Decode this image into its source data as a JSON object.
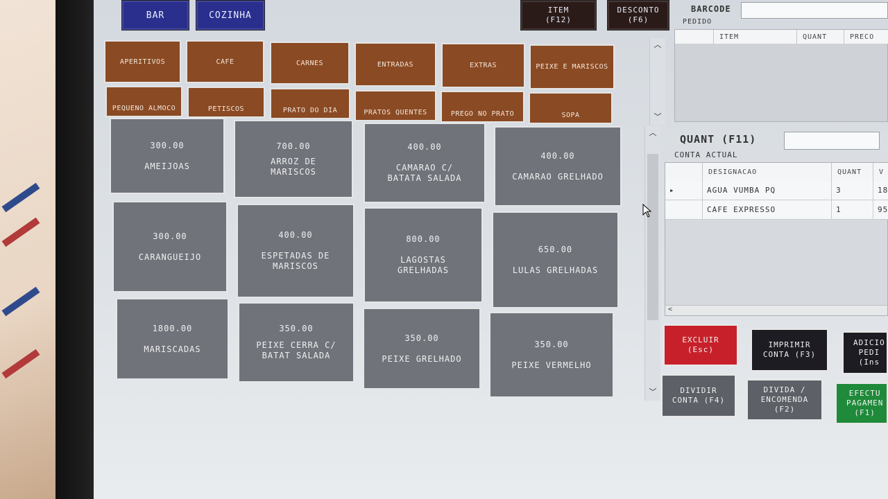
{
  "top_buttons": {
    "bar": "BAR",
    "cozinha": "COZINHA",
    "item": "ITEM\n(F12)",
    "desconto": "DESCONTO\n(F6)"
  },
  "barcode": {
    "label": "BARCODE",
    "value": ""
  },
  "pedido": {
    "label": "PEDIDO",
    "columns": [
      "ITEM",
      "QUANT",
      "PRECO"
    ]
  },
  "categories": [
    "APERITIVOS",
    "CAFE",
    "CARNES",
    "ENTRADAS",
    "EXTRAS",
    "PEIXE E MARISCOS",
    "PEQUENO ALMOCO",
    "PETISCOS",
    "PRATO DO DIA",
    "PRATOS QUENTES",
    "PREGO NO PRATO",
    "SOPA"
  ],
  "products": [
    {
      "price": "300.00",
      "name": "AMEIJOAS"
    },
    {
      "price": "700.00",
      "name": "ARROZ DE MARISCOS"
    },
    {
      "price": "400.00",
      "name": "CAMARAO C/ BATATA  SALADA"
    },
    {
      "price": "400.00",
      "name": "CAMARAO GRELHADO"
    },
    {
      "price": "300.00",
      "name": "CARANGUEIJO"
    },
    {
      "price": "400.00",
      "name": "ESPETADAS DE MARISCOS"
    },
    {
      "price": "800.00",
      "name": "LAGOSTAS GRELHADAS"
    },
    {
      "price": "650.00",
      "name": "LULAS GRELHADAS"
    },
    {
      "price": "1800.00",
      "name": "MARISCADAS"
    },
    {
      "price": "350.00",
      "name": "PEIXE CERRA C/ BATAT  SALADA"
    },
    {
      "price": "350.00",
      "name": "PEIXE GRELHADO"
    },
    {
      "price": "350.00",
      "name": "PEIXE VERMELHO"
    }
  ],
  "quant": {
    "label": "QUANT (F11)",
    "value": ""
  },
  "conta_actual": {
    "label": "CONTA ACTUAL",
    "columns": [
      "DESIGNACAO",
      "QUANT",
      "V"
    ],
    "rows": [
      {
        "marker": "▸",
        "designacao": "AGUA VUMBA PQ",
        "quant": "3",
        "valor": "18"
      },
      {
        "marker": "",
        "designacao": "CAFE EXPRESSO",
        "quant": "1",
        "valor": "95"
      }
    ]
  },
  "actions": {
    "excluir": "EXCLUIR\n(Esc)",
    "imprimir": "IMPRIMIR\nCONTA (F3)",
    "adicionar": "ADICIO\nPEDI\n(Ins",
    "dividir": "DIVIDIR\nCONTA (F4)",
    "divida": "DIVIDA /\nENCOMENDA\n(F2)",
    "efectuar": "EFECTU\nPAGAMEN\n(F1)"
  },
  "colors": {
    "category": "#8a4a23",
    "product": "#70737a",
    "excluir": "#c8202a",
    "dark": "#1c1c22",
    "divide": "#5d6066",
    "efectuar": "#1f8a3a",
    "blue": "#2a2f8e"
  }
}
